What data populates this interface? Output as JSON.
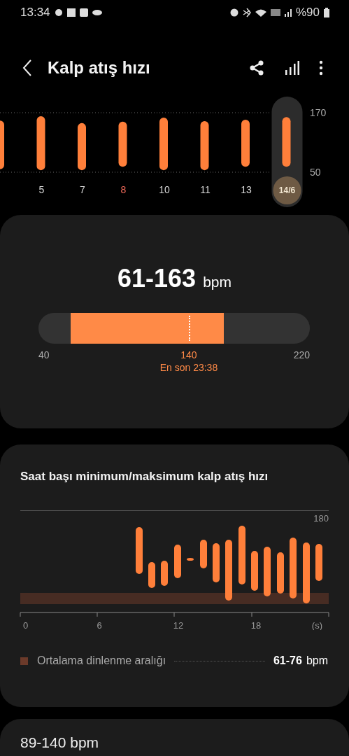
{
  "status_bar": {
    "time": "13:34",
    "battery": "%90"
  },
  "header": {
    "title": "Kalp atış hızı"
  },
  "daily_chart": {
    "y_labels": [
      "170",
      "50"
    ],
    "days": [
      {
        "label": "5",
        "selected": false,
        "color": "#d9d9d9"
      },
      {
        "label": "7",
        "selected": false,
        "color": "#d9d9d9"
      },
      {
        "label": "8",
        "selected": false,
        "color": "#f06a5a"
      },
      {
        "label": "10",
        "selected": false,
        "color": "#d9d9d9"
      },
      {
        "label": "11",
        "selected": false,
        "color": "#d9d9d9"
      },
      {
        "label": "13",
        "selected": false,
        "color": "#d9d9d9"
      },
      {
        "label": "14/6",
        "selected": true,
        "color": "#f2e6d0"
      }
    ]
  },
  "summary": {
    "range": "61-163",
    "unit": "bpm",
    "latest": {
      "level": 0.554,
      "value": "140",
      "caption": "En son 23:38"
    },
    "min_label": "40",
    "max_label": "220"
  },
  "hourly": {
    "title": "Saat başı minimum/maksimum kalp atış hızı",
    "y_label": "180",
    "x_labels": [
      "0",
      "6",
      "12",
      "18",
      "(s)"
    ],
    "legend": {
      "label": "Ortalama dinlenme aralığı",
      "value": "61-76",
      "unit": "bpm",
      "color": "#6b3a2a"
    }
  },
  "record": {
    "range": "89-140 bpm"
  }
}
